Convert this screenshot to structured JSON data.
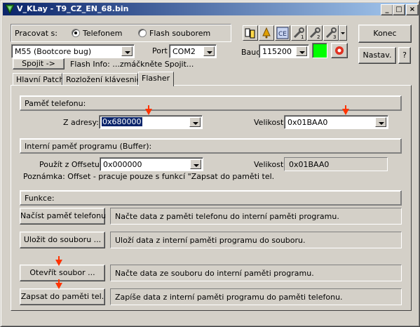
{
  "window": {
    "title": "V_KLay - T9_CZ_EN_68.bin"
  },
  "top": {
    "pracovat_label": "Pracovat s:",
    "radio_phone": "Telefonem",
    "radio_file": "Flash souborem",
    "model_value": "M55 (Bootcore bug)",
    "port_label": "Port",
    "port_value": "COM2",
    "baud_label": "Baud",
    "baud_value": "115200",
    "connect_label": "Spojit ->",
    "flash_info": "Flash Info: ...zmáčkněte Spojit...",
    "konec_label": "Konec",
    "nastav_label": "Nastav.",
    "help_label": "?",
    "status_color": "#00ff00"
  },
  "tabs": [
    "Hlavní Patch",
    "Rozložení klávesnice",
    "Flasher"
  ],
  "flasher": {
    "phone_mem_header": "Paměť telefonu:",
    "from_addr_label": "Z adresy:",
    "from_addr_value": "0x680000",
    "size_label": "Velikost:",
    "size_value": "0x01BAA0",
    "internal_header": "Interní paměť programu (Buffer):",
    "offset_label": "Použít z Offsetu:",
    "offset_value": "0x000000",
    "internal_size_label": "Velikost:",
    "internal_size_value": "0x01BAA0",
    "note": "Poznámka: Offset - pracuje pouze s funkcí \"Zapsat do paměti tel.",
    "functions_header": "Funkce:",
    "actions": [
      {
        "button": "Načíst paměť telefonu",
        "desc": "Načte data z paměti telefonu do interní paměti programu."
      },
      {
        "button": "Uložit do souboru ...",
        "desc": "Uloží data z interní paměti programu do souboru."
      },
      {
        "button": "Otevřít soubor ...",
        "desc": "Načte data ze souboru do interní paměti programu."
      },
      {
        "button": "Zapsat do paměti tel.",
        "desc": "Zapíše data z interní paměti programu do paměti telefonu."
      }
    ]
  }
}
